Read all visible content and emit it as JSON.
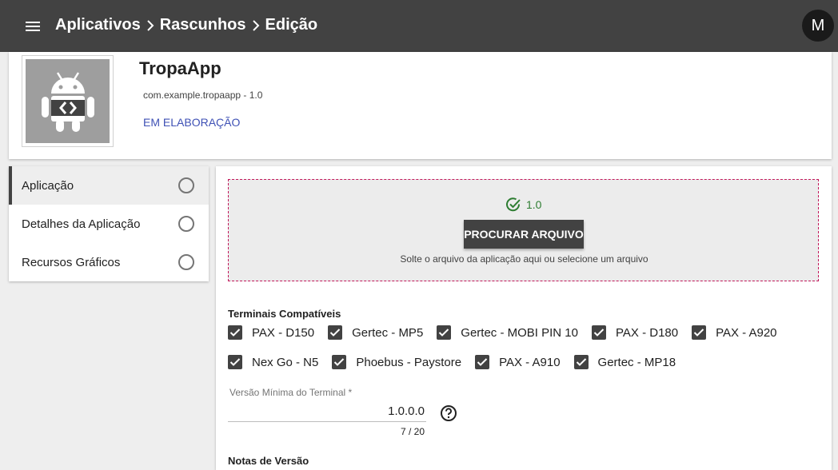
{
  "topbar": {
    "breadcrumbs": [
      "Aplicativos",
      "Rascunhos",
      "Edição"
    ],
    "avatar_initial": "M"
  },
  "app": {
    "name": "TropaApp",
    "package_version": "com.example.tropaapp - 1.0",
    "status": "EM ELABORAÇÃO",
    "icon": "android-robot-icon"
  },
  "stepper": {
    "steps": [
      {
        "label": "Aplicação",
        "active": true
      },
      {
        "label": "Detalhes da Aplicação",
        "active": false
      },
      {
        "label": "Recursos Gráficos",
        "active": false
      }
    ]
  },
  "upload": {
    "version": "1.0",
    "button_label": "PROCURAR ARQUIVO",
    "hint": "Solte o arquivo da aplicação aqui ou selecione um arquivo"
  },
  "terminals": {
    "title": "Terminais Compatíveis",
    "row1": [
      "PAX - D150",
      "Gertec - MP5",
      "Gertec - MOBI PIN 10",
      "PAX - D180",
      "PAX - A920"
    ],
    "row2": [
      "Nex Go - N5",
      "Phoebus - Paystore",
      "PAX - A910",
      "Gertec - MP18"
    ]
  },
  "min_version": {
    "label": "Versão Mínima do Terminal *",
    "value": "1.0.0.0",
    "counter": "7 / 20"
  },
  "release_notes": {
    "title": "Notas de Versão"
  },
  "colors": {
    "topbar": "#424242",
    "accent_status": "#3f51b5",
    "success": "#2e7d32",
    "dropzone_border": "#c2185b"
  }
}
